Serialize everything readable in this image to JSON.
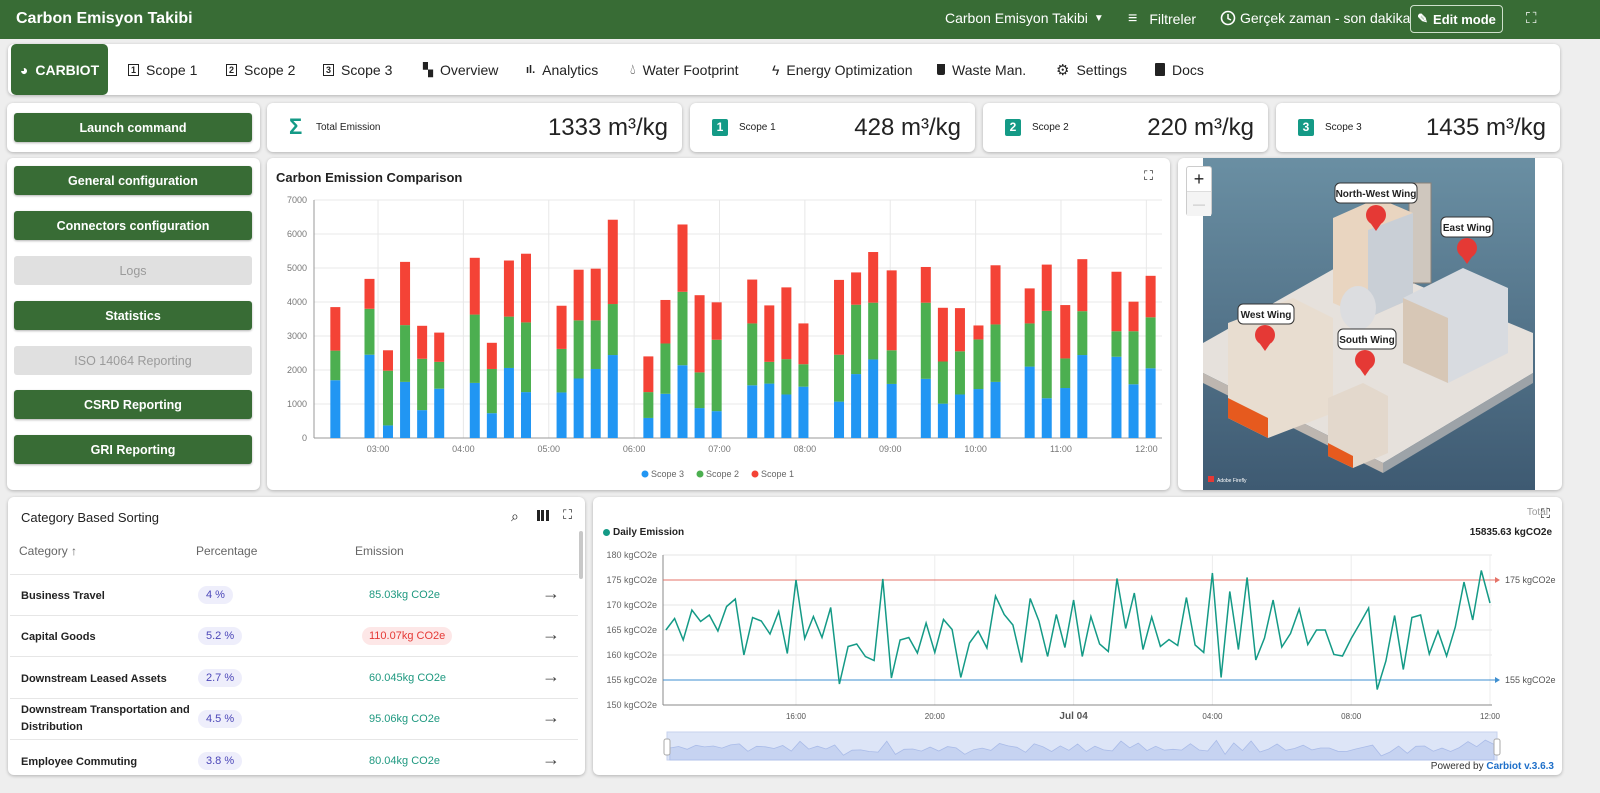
{
  "header": {
    "title": "Carbon Emisyon Takibi",
    "dashboard_select": "Carbon Emisyon Takibi",
    "filters": "Filtreler",
    "time_range": "Gerçek zaman - son dakika",
    "edit_mode": "Edit mode"
  },
  "tabs": [
    {
      "label": "CARBIOT",
      "icon": "carbiot-logo-icon",
      "active": true
    },
    {
      "label": "Scope 1",
      "icon": "scope-1-icon"
    },
    {
      "label": "Scope 2",
      "icon": "scope-2-icon"
    },
    {
      "label": "Scope 3",
      "icon": "scope-3-icon"
    },
    {
      "label": "Overview",
      "icon": "dashboard-icon"
    },
    {
      "label": "Analytics",
      "icon": "bar-chart-icon"
    },
    {
      "label": "Water Footprint",
      "icon": "water-drop-icon"
    },
    {
      "label": "Energy Optimization",
      "icon": "bolt-icon"
    },
    {
      "label": "Waste Man.",
      "icon": "trash-icon"
    },
    {
      "label": "Settings",
      "icon": "gear-icon"
    },
    {
      "label": "Docs",
      "icon": "document-icon"
    }
  ],
  "sidebar": {
    "launch": "Launch command",
    "buttons": [
      {
        "label": "General configuration",
        "enabled": true
      },
      {
        "label": "Connectors configuration",
        "enabled": true
      },
      {
        "label": "Logs",
        "enabled": false
      },
      {
        "label": "Statistics",
        "enabled": true
      },
      {
        "label": "ISO 14064 Reporting",
        "enabled": false
      },
      {
        "label": "CSRD Reporting",
        "enabled": true
      },
      {
        "label": "GRI Reporting",
        "enabled": true
      }
    ]
  },
  "kpis": [
    {
      "label": "Total Emission",
      "value": "1333 m³/kg",
      "badge": "Σ"
    },
    {
      "label": "Scope 1",
      "value": "428 m³/kg",
      "badge": "1"
    },
    {
      "label": "Scope 2",
      "value": "220 m³/kg",
      "badge": "2"
    },
    {
      "label": "Scope 3",
      "value": "1435 m³/kg",
      "badge": "3"
    }
  ],
  "colors": {
    "brand": "#386c35",
    "accent": "#149a86",
    "scope3": "#2196f3",
    "scope2": "#4caf50",
    "scope1": "#f44336"
  },
  "chart_data": [
    {
      "type": "bar",
      "stacked": true,
      "title": "Carbon Emission Comparison",
      "ylim": [
        0,
        7000
      ],
      "yticks": [
        "0",
        "1000",
        "2000",
        "3000",
        "4000",
        "5000",
        "6000",
        "7000"
      ],
      "xticks": [
        "03:00",
        "04:00",
        "05:00",
        "06:00",
        "07:00",
        "08:00",
        "09:00",
        "10:00",
        "11:00",
        "12:00"
      ],
      "grid": true,
      "legend": "bottom",
      "x": [
        "02:30",
        "02:54",
        "03:07",
        "03:19",
        "03:31",
        "03:43",
        "04:08",
        "04:20",
        "04:32",
        "04:44",
        "05:09",
        "05:21",
        "05:33",
        "05:45",
        "06:10",
        "06:22",
        "06:34",
        "06:46",
        "06:58",
        "07:23",
        "07:35",
        "07:47",
        "07:59",
        "08:24",
        "08:36",
        "08:48",
        "09:01",
        "09:25",
        "09:37",
        "09:49",
        "10:02",
        "10:14",
        "10:38",
        "10:50",
        "11:03",
        "11:15",
        "11:39",
        "11:51",
        "12:03"
      ],
      "series": [
        {
          "name": "Scope 3",
          "color": "#2196f3",
          "values": [
            1700,
            2450,
            370,
            1650,
            820,
            1450,
            1620,
            730,
            2060,
            1350,
            1340,
            1750,
            2030,
            2440,
            590,
            1300,
            2140,
            880,
            790,
            1550,
            1600,
            1280,
            1510,
            1070,
            1880,
            2310,
            1590,
            1740,
            1010,
            1280,
            1440,
            1650,
            2100,
            1170,
            1470,
            2440,
            2390,
            1580,
            2050
          ]
        },
        {
          "name": "Scope 2",
          "color": "#4caf50",
          "values": [
            870,
            1350,
            1610,
            1670,
            1510,
            790,
            2010,
            1300,
            1510,
            2050,
            1280,
            1710,
            1430,
            1500,
            760,
            1480,
            2160,
            1050,
            2100,
            1820,
            640,
            1040,
            660,
            1380,
            2040,
            1670,
            990,
            2240,
            1240,
            1270,
            1460,
            1690,
            1270,
            2570,
            870,
            1290,
            750,
            1560,
            1500
          ]
        },
        {
          "name": "Scope 1",
          "color": "#f44336",
          "values": [
            1280,
            880,
            600,
            1860,
            970,
            860,
            1670,
            770,
            1650,
            2020,
            1270,
            1490,
            1520,
            2480,
            1050,
            1280,
            1980,
            2270,
            1100,
            1290,
            1660,
            2110,
            1200,
            2200,
            950,
            1490,
            2350,
            1050,
            1580,
            1270,
            410,
            1740,
            1030,
            1360,
            1570,
            1530,
            1750,
            870,
            1220
          ]
        }
      ]
    },
    {
      "type": "line",
      "legend": "Daily Emission",
      "total_label": "Total",
      "total": "15835.63 kgCO2e",
      "ylim": [
        150,
        180
      ],
      "yticks": [
        "150 kgCO2e",
        "155 kgCO2e",
        "160 kgCO2e",
        "165 kgCO2e",
        "170 kgCO2e",
        "175 kgCO2e",
        "180 kgCO2e"
      ],
      "xticks": [
        "16:00",
        "20:00",
        "Jul 04",
        "04:00",
        "08:00",
        "12:00"
      ],
      "color": "#149a86",
      "marklines": [
        {
          "value": 175,
          "label": "175 kgCO2e",
          "color": "#e57368"
        },
        {
          "value": 155,
          "label": "155 kgCO2e",
          "color": "#3f8fd0"
        }
      ],
      "x": [
        "12:15",
        "12:30",
        "12:45",
        "13:00",
        "13:15",
        "13:30",
        "13:45",
        "14:00",
        "14:15",
        "14:30",
        "14:45",
        "15:00",
        "15:15",
        "15:30",
        "15:45",
        "16:00",
        "16:15",
        "16:30",
        "16:45",
        "17:00",
        "17:15",
        "17:30",
        "17:45",
        "18:00",
        "18:15",
        "18:30",
        "18:45",
        "19:00",
        "19:15",
        "19:30",
        "19:45",
        "20:00",
        "20:15",
        "20:30",
        "20:45",
        "21:00",
        "21:15",
        "21:30",
        "21:45",
        "22:00",
        "22:15",
        "22:30",
        "22:45",
        "23:00",
        "23:15",
        "23:30",
        "23:45",
        "00:00",
        "00:15",
        "00:30",
        "00:45",
        "01:00",
        "01:15",
        "01:30",
        "01:45",
        "02:00",
        "02:15",
        "02:30",
        "02:45",
        "03:00",
        "03:15",
        "03:30",
        "03:45",
        "04:00",
        "04:15",
        "04:30",
        "04:45",
        "05:00",
        "05:15",
        "05:30",
        "05:45",
        "06:00",
        "06:15",
        "06:30",
        "06:45",
        "07:00",
        "07:15",
        "07:30",
        "07:45",
        "08:00",
        "08:15",
        "08:30",
        "08:45",
        "09:00",
        "09:15",
        "09:30",
        "09:45",
        "10:00",
        "10:15",
        "10:30",
        "10:45",
        "11:00",
        "11:15",
        "11:30",
        "11:45",
        "12:00"
      ],
      "values": [
        165,
        167.3,
        163,
        169,
        166.7,
        168,
        164.8,
        169.7,
        171.2,
        160,
        167.5,
        166.8,
        164.2,
        168.7,
        160.3,
        175,
        163.3,
        167.7,
        163.5,
        169.5,
        154.2,
        161.7,
        162.2,
        159.7,
        158.9,
        175.2,
        155.4,
        163,
        163.5,
        160.4,
        166.4,
        160.5,
        167.1,
        165.1,
        155.5,
        162.4,
        164.8,
        161.4,
        171.8,
        168.1,
        166,
        158.5,
        171.3,
        166.8,
        159.7,
        168.1,
        161.5,
        171,
        159.7,
        167.7,
        162.2,
        160.7,
        175.3,
        165.3,
        172.4,
        161.1,
        167.6,
        161.7,
        163.1,
        161.9,
        171.5,
        162,
        160.5,
        176.4,
        155.5,
        172.7,
        161.1,
        175.5,
        159,
        163.4,
        171,
        161.6,
        164.3,
        169.2,
        162.1,
        165,
        165,
        160.1,
        159.8,
        163.3,
        166.3,
        169.4,
        153.1,
        158.8,
        167.9,
        157.1,
        167.5,
        168,
        160.2,
        164.8,
        159.8,
        165.6,
        174.6,
        167,
        176.9,
        170.4
      ]
    }
  ],
  "map": {
    "zoom_in": "+",
    "zoom_out": "—",
    "markers": [
      {
        "label": "North-West Wing"
      },
      {
        "label": "East Wing"
      },
      {
        "label": "West Wing"
      },
      {
        "label": "South Wing"
      }
    ],
    "watermark": "Adobe Firefly"
  },
  "table": {
    "title": "Category Based Sorting",
    "columns": [
      "Category",
      "Percentage",
      "Emission"
    ],
    "sort_indicator": "↑",
    "rows": [
      {
        "category": "Business Travel",
        "percentage": "4 %",
        "emission": "85.03kg CO2e",
        "high": false
      },
      {
        "category": "Capital Goods",
        "percentage": "5.2 %",
        "emission": "110.07kg CO2e",
        "high": true
      },
      {
        "category": "Downstream Leased Assets",
        "percentage": "2.7 %",
        "emission": "60.045kg CO2e",
        "high": false
      },
      {
        "category": "Downstream Transportation and Distribution",
        "percentage": "4.5 %",
        "emission": "95.06kg CO2e",
        "high": false
      },
      {
        "category": "Employee Commuting",
        "percentage": "3.8 %",
        "emission": "80.04kg CO2e",
        "high": false
      }
    ]
  },
  "footer": {
    "powered_by": "Powered by",
    "version": "Carbiot v.3.6.3"
  }
}
